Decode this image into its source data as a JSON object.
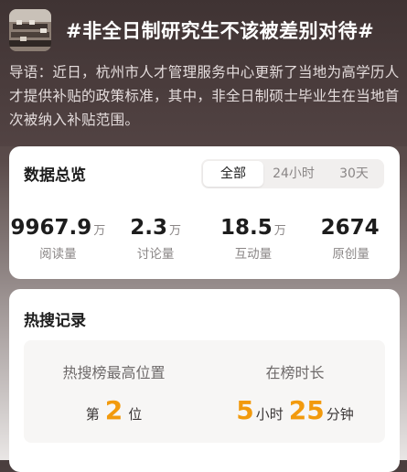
{
  "topic": {
    "title": "#非全日制研究生不该被差别对待#",
    "lead": "导语：近日，杭州市人才管理服务中心更新了当地为高学历人才提供补贴的政策标准，其中，非全日制硕士毕业生在当地首次被纳入补贴范围。",
    "thumbnail_icon": "classroom-photo-thumbnail"
  },
  "stats": {
    "title": "数据总览",
    "tabs": [
      {
        "label": "全部",
        "active": true
      },
      {
        "label": "24小时",
        "active": false
      },
      {
        "label": "30天",
        "active": false
      }
    ],
    "metrics": [
      {
        "value": "9967.9",
        "unit": "万",
        "label": "阅读量"
      },
      {
        "value": "2.3",
        "unit": "万",
        "label": "讨论量"
      },
      {
        "value": "18.5",
        "unit": "万",
        "label": "互动量"
      },
      {
        "value": "2674",
        "unit": "",
        "label": "原创量"
      }
    ]
  },
  "hot": {
    "title": "热搜记录",
    "peak": {
      "label": "热搜榜最高位置",
      "prefix": "第",
      "value": "2",
      "suffix": "位"
    },
    "duration": {
      "label": "在榜时长",
      "hours": "5",
      "hours_unit": "小时",
      "minutes": "25",
      "minutes_unit": "分钟"
    }
  },
  "colors": {
    "accent": "#f29a0d",
    "hero_bg": "#4a3e3e"
  }
}
